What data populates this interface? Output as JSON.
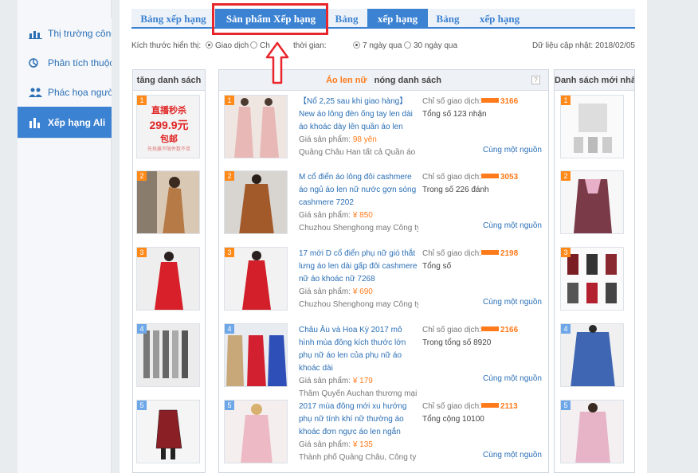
{
  "sidebar": {
    "items": [
      {
        "label": "Thị trường công",
        "icon": "bar-chart-icon"
      },
      {
        "label": "Phân tích thuộc",
        "icon": "attribute-icon"
      },
      {
        "label": "Phác họa người",
        "icon": "people-icon"
      },
      {
        "label": "Xếp hạng Ali",
        "icon": "ranking-icon"
      }
    ]
  },
  "tabs": [
    "Bảng xếp hạng",
    "Sản phẩm Xếp hạng",
    "Bảng",
    "xếp hạng",
    "Bảng",
    "xếp hạng"
  ],
  "filters": {
    "size_label": "Kích thước hiển thị:",
    "opt1": "Giao dịch",
    "opt2": "Ch",
    "time_label": "thời gian:",
    "opt3": "7 ngày qua",
    "opt4": "30 ngày qua",
    "updated": "Dữ liệu cập nhật: 2018/02/05"
  },
  "panels": {
    "left_title": "tăng danh sách",
    "mid_title_hl": "Áo len nữ",
    "mid_title": "nóng danh sách",
    "help": "?",
    "right_title": "Danh sách mới nhất"
  },
  "promo": {
    "line1": "直播秒杀",
    "price": "299.9元",
    "line2": "包邮",
    "line3": "先抢赢不限件数不单"
  },
  "products": [
    {
      "rank": "1",
      "title": "【Nổ 2,25 sau khi giao hàng】New áo lông đèn ống tay len dài áo khoác dày lên quần áo len",
      "price_label": "Giá sản phẩm: ",
      "price": "98 yên",
      "shop": "Quảng Châu Han tất cả Quần áo",
      "stat_label": "Chỉ số giao dịch:",
      "stat_value": "3166",
      "stat_line2": "Tổng số 123 nhận",
      "same": "Cùng một nguồn"
    },
    {
      "rank": "2",
      "title": "M cổ điển áo lông đôi cashmere áo ngủ áo len nữ nước gợn sóng cashmere 7202",
      "price_label": "Giá sản phẩm: ",
      "price": "¥ 850",
      "shop": "Chuzhou Shenghong may Công ty",
      "stat_label": "Chỉ số giao dịch:",
      "stat_value": "3053",
      "stat_line2": "Trong số 226 đánh",
      "same": "Cùng một nguồn"
    },
    {
      "rank": "3",
      "title": "17 mới D cổ điển phụ nữ gió thắt lưng áo len dài gấp đôi cashmere nữ áo khoác nữ 7268",
      "price_label": "Giá sản phẩm: ",
      "price": "¥ 690",
      "shop": "Chuzhou Shenghong may Công ty",
      "stat_label": "Chỉ số giao dịch:",
      "stat_value": "2198",
      "stat_line2": "Tổng số",
      "same": "Cùng một nguồn"
    },
    {
      "rank": "4",
      "title": "Châu Âu và Hoa Kỳ 2017 mô hình mùa đông kích thước lớn phụ nữ áo len của phụ nữ áo khoác dài",
      "price_label": "Giá sản phẩm: ",
      "price": "¥ 179",
      "shop": "Thâm Quyến Auchan thương mại",
      "stat_label": "Chỉ số giao dịch:",
      "stat_value": "2166",
      "stat_line2": "Trong tổng số 8920",
      "same": "Cùng một nguồn"
    },
    {
      "rank": "5",
      "title": "2017 mùa đông mới xu hướng phụ nữ tính khí nữ thường áo khoác đơn ngực áo len ngắn",
      "price_label": "Giá sản phẩm: ",
      "price": "¥ 135",
      "shop": "Thành phố Quảng Châu, Công ty",
      "stat_label": "Chỉ số giao dịch:",
      "stat_value": "2113",
      "stat_line2": "Tổng cộng 10100",
      "same": "Cùng một nguồn"
    }
  ],
  "colors": {
    "accent": "#3c82d2",
    "orange": "#ff7a1a",
    "highlight": "#e8262b"
  }
}
